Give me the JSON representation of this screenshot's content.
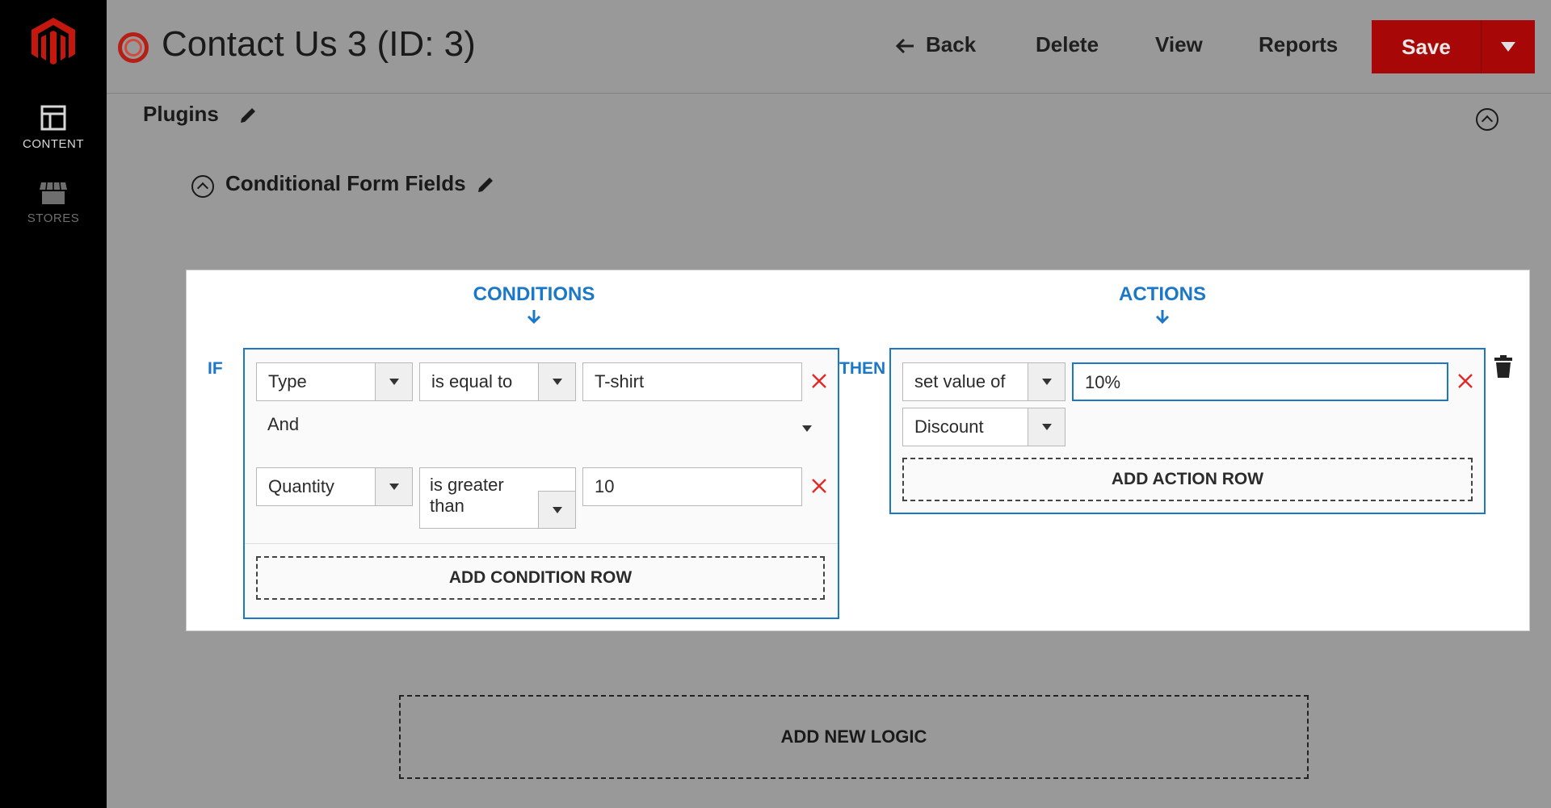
{
  "sidebar": {
    "items": [
      {
        "label": "CONTENT",
        "icon": "content-icon"
      },
      {
        "label": "STORES",
        "icon": "store-icon"
      }
    ]
  },
  "header": {
    "title": "Contact Us 3 (ID: 3)",
    "back_label": "Back",
    "delete_label": "Delete",
    "view_label": "View",
    "reports_label": "Reports",
    "save_label": "Save"
  },
  "plugins": {
    "title": "Plugins",
    "section_title": "Conditional Form Fields"
  },
  "logic": {
    "conditions_heading": "CONDITIONS",
    "actions_heading": "ACTIONS",
    "if_label": "IF",
    "then_label": "THEN",
    "conditions": [
      {
        "field": "Type",
        "operator": "is equal to",
        "value": "T-shirt"
      },
      {
        "field": "Quantity",
        "operator_line1": "is greater",
        "operator_line2": "than",
        "value": "10"
      }
    ],
    "join": "And",
    "add_condition_label": "ADD CONDITION ROW",
    "action": {
      "type": "set value of",
      "value": "10%",
      "target": "Discount"
    },
    "add_action_label": "ADD ACTION ROW"
  },
  "add_new_logic_label": "ADD NEW LOGIC",
  "colors": {
    "accent": "#1b78c8",
    "save": "#a80707",
    "remove": "#e02b27",
    "sidebar": "#000000",
    "overlay": "#999999"
  }
}
